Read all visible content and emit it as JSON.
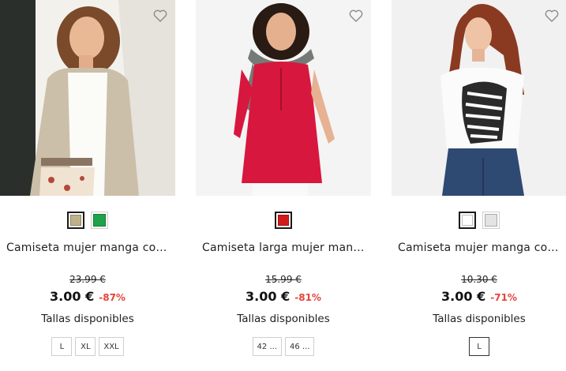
{
  "accent": {
    "discount": "#e4453a"
  },
  "products": [
    {
      "name": "Camiseta mujer manga cort...",
      "old_price": "23.99 €",
      "price": "3.00 €",
      "discount": "-87%",
      "sizes_label": "Tallas disponibles",
      "colors": [
        "#bfb18a",
        "#1ea34a"
      ],
      "sizes": [
        "L",
        "XL",
        "XXL"
      ],
      "wishlist_icon": "heart-outline"
    },
    {
      "name": "Camiseta larga mujer mang...",
      "old_price": "15.99 €",
      "price": "3.00 €",
      "discount": "-81%",
      "sizes_label": "Tallas disponibles",
      "colors": [
        "#d21a1a"
      ],
      "sizes": [
        "42 ...",
        "46 ..."
      ],
      "wishlist_icon": "heart-outline"
    },
    {
      "name": "Camiseta mujer manga cort...",
      "old_price": "10.30 €",
      "price": "3.00 €",
      "discount": "-71%",
      "sizes_label": "Tallas disponibles",
      "colors": [
        "#ffffff",
        "#e3e3e3"
      ],
      "sizes": [
        "L"
      ],
      "wishlist_icon": "heart-outline"
    }
  ]
}
